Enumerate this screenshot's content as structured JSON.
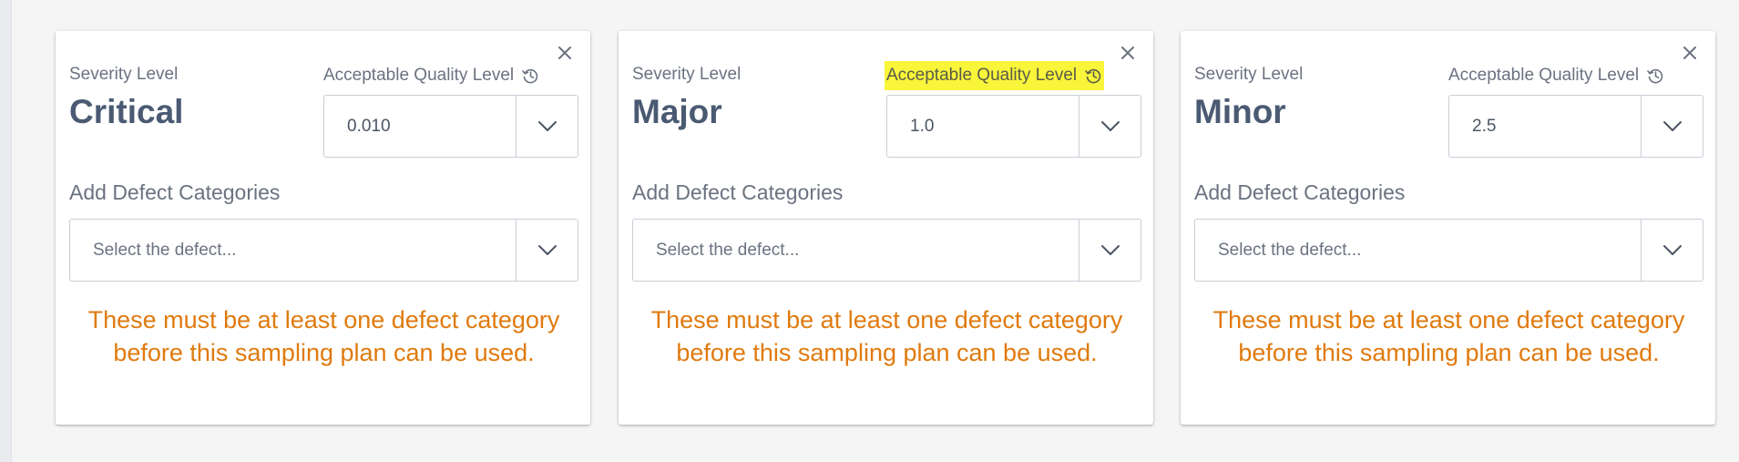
{
  "cards": [
    {
      "severity_label": "Severity Level",
      "severity_value": "Critical",
      "aql_label": "Acceptable Quality Level",
      "aql_value": "0.010",
      "add_label": "Add Defect Categories",
      "defect_placeholder": "Select the defect...",
      "warning": "These must be at least one defect category before this sampling plan can be used."
    },
    {
      "severity_label": "Severity Level",
      "severity_value": "Major",
      "aql_label": "Acceptable Quality Level",
      "aql_value": "1.0",
      "add_label": "Add Defect Categories",
      "defect_placeholder": "Select the defect...",
      "warning": "These must be at least one defect category before this sampling plan can be used."
    },
    {
      "severity_label": "Severity Level",
      "severity_value": "Minor",
      "aql_label": "Acceptable Quality Level",
      "aql_value": "2.5",
      "add_label": "Add Defect Categories",
      "defect_placeholder": "Select the defect...",
      "warning": "These must be at least one defect category before this sampling plan can be used."
    }
  ],
  "icons": {
    "close": "close-icon",
    "history": "history-icon",
    "dropdown": "chevron-down-icon"
  },
  "colors": {
    "severity_text": "#4a5a72",
    "warning_text": "#e07a0e",
    "highlight": "#f8f53a"
  }
}
